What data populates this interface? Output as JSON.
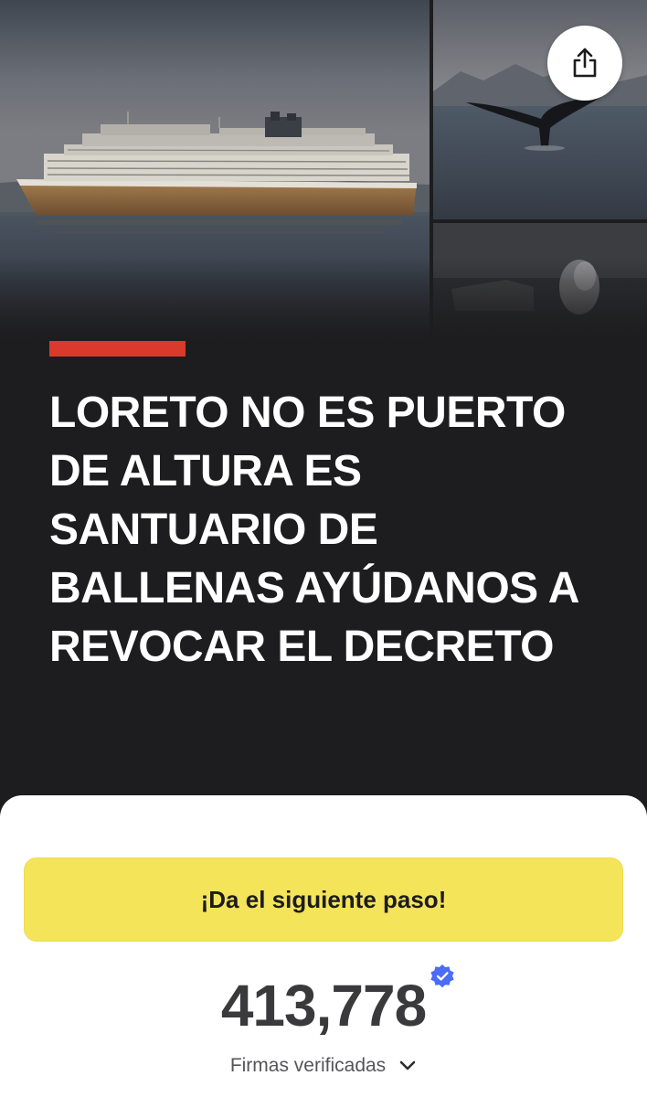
{
  "hero": {
    "images": [
      "cruise-ship-photo",
      "whale-tail-photo",
      "whale-spout-photo"
    ]
  },
  "share": {
    "icon": "share-icon"
  },
  "petition": {
    "title": "LORETO NO ES PUERTO DE ALTURA ES SANTUARIO DE BALLENAS AYÚDANOS A REVOCAR EL DECRETO",
    "accent_color": "#d93a2b"
  },
  "card": {
    "cta_label": "¡Da el siguiente paso!",
    "cta_color": "#f4e45a",
    "signature_count": "413,778",
    "verified_label": "Firmas verificadas",
    "verified_badge_color": "#4a6cf7"
  }
}
